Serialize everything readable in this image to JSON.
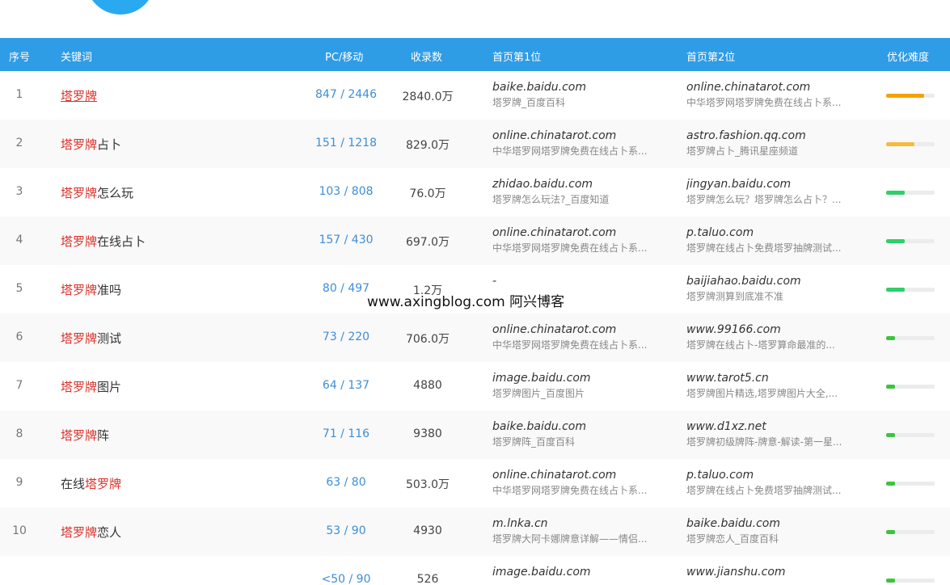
{
  "header": {
    "col_index": "序号",
    "col_keyword": "关键词",
    "col_pc_mobile": "PC/移动",
    "col_indexed": "收录数",
    "col_first": "首页第1位",
    "col_second": "首页第2位",
    "col_difficulty": "优化难度"
  },
  "watermark": "www.axingblog.com 阿兴博客",
  "colors": {
    "header_bg": "#2f9ce6",
    "highlight": "#d9332b",
    "pc_mobile": "#3d8ed8",
    "difficulty_high": "#f5a100",
    "difficulty_medium": "#f3bc3e",
    "difficulty_low": "#2dd06a",
    "difficulty_min": "#3cc43c"
  },
  "rows": [
    {
      "index": "1",
      "kw_prefix": "",
      "kw_highlight": "塔罗牌",
      "kw_suffix": "",
      "pc_mobile": "847 / 2446",
      "indexed": "2840.0万",
      "first_domain": "baike.baidu.com",
      "first_title": "塔罗牌_百度百科",
      "second_domain": "online.chinatarot.com",
      "second_title": "中华塔罗网塔罗牌免费在线占卜系...",
      "difficulty": 0.78,
      "difficulty_color": "#f5a100"
    },
    {
      "index": "2",
      "kw_prefix": "",
      "kw_highlight": "塔罗牌",
      "kw_suffix": "占卜",
      "pc_mobile": "151 / 1218",
      "indexed": "829.0万",
      "first_domain": "online.chinatarot.com",
      "first_title": "中华塔罗网塔罗牌免费在线占卜系...",
      "second_domain": "astro.fashion.qq.com",
      "second_title": "塔罗牌占卜_腾讯星座频道",
      "difficulty": 0.58,
      "difficulty_color": "#f3bc3e"
    },
    {
      "index": "3",
      "kw_prefix": "",
      "kw_highlight": "塔罗牌",
      "kw_suffix": "怎么玩",
      "pc_mobile": "103 / 808",
      "indexed": "76.0万",
      "first_domain": "zhidao.baidu.com",
      "first_title": "塔罗牌怎么玩法?_百度知道",
      "second_domain": "jingyan.baidu.com",
      "second_title": "塔罗牌怎么玩？塔罗牌怎么占卜？...",
      "difficulty": 0.38,
      "difficulty_color": "#2dd06a"
    },
    {
      "index": "4",
      "kw_prefix": "",
      "kw_highlight": "塔罗牌",
      "kw_suffix": "在线占卜",
      "pc_mobile": "157 / 430",
      "indexed": "697.0万",
      "first_domain": "online.chinatarot.com",
      "first_title": "中华塔罗网塔罗牌免费在线占卜系...",
      "second_domain": "p.taluo.com",
      "second_title": "塔罗牌在线占卜免费塔罗抽牌测试...",
      "difficulty": 0.38,
      "difficulty_color": "#2dd06a"
    },
    {
      "index": "5",
      "kw_prefix": "",
      "kw_highlight": "塔罗牌",
      "kw_suffix": "准吗",
      "pc_mobile": "80 / 497",
      "indexed": "1.2万",
      "first_domain": "-",
      "first_title": "",
      "second_domain": "baijiahao.baidu.com",
      "second_title": "塔罗牌测算到底准不准",
      "difficulty": 0.38,
      "difficulty_color": "#2dd06a"
    },
    {
      "index": "6",
      "kw_prefix": "",
      "kw_highlight": "塔罗牌",
      "kw_suffix": "测试",
      "pc_mobile": "73 / 220",
      "indexed": "706.0万",
      "first_domain": "online.chinatarot.com",
      "first_title": "中华塔罗网塔罗牌免费在线占卜系...",
      "second_domain": "www.99166.com",
      "second_title": "塔罗牌在线占卜-塔罗算命最准的...",
      "difficulty": 0.18,
      "difficulty_color": "#3cc43c"
    },
    {
      "index": "7",
      "kw_prefix": "",
      "kw_highlight": "塔罗牌",
      "kw_suffix": "图片",
      "pc_mobile": "64 / 137",
      "indexed": "4880",
      "first_domain": "image.baidu.com",
      "first_title": "塔罗牌图片_百度图片",
      "second_domain": "www.tarot5.cn",
      "second_title": "塔罗牌图片精选,塔罗牌图片大全,...",
      "difficulty": 0.18,
      "difficulty_color": "#3cc43c"
    },
    {
      "index": "8",
      "kw_prefix": "",
      "kw_highlight": "塔罗牌",
      "kw_suffix": "阵",
      "pc_mobile": "71 / 116",
      "indexed": "9380",
      "first_domain": "baike.baidu.com",
      "first_title": "塔罗牌阵_百度百科",
      "second_domain": "www.d1xz.net",
      "second_title": "塔罗牌初级牌阵-牌意-解读-第一星...",
      "difficulty": 0.18,
      "difficulty_color": "#3cc43c"
    },
    {
      "index": "9",
      "kw_prefix": "在线",
      "kw_highlight": "塔罗牌",
      "kw_suffix": "",
      "pc_mobile": "63 / 80",
      "indexed": "503.0万",
      "first_domain": "online.chinatarot.com",
      "first_title": "中华塔罗网塔罗牌免费在线占卜系...",
      "second_domain": "p.taluo.com",
      "second_title": "塔罗牌在线占卜免费塔罗抽牌测试...",
      "difficulty": 0.18,
      "difficulty_color": "#3cc43c"
    },
    {
      "index": "10",
      "kw_prefix": "",
      "kw_highlight": "塔罗牌",
      "kw_suffix": "恋人",
      "pc_mobile": "53 / 90",
      "indexed": "4930",
      "first_domain": "m.lnka.cn",
      "first_title": "塔罗牌大阿卡娜牌意详解——情侣...",
      "second_domain": "baike.baidu.com",
      "second_title": "塔罗牌恋人_百度百科",
      "difficulty": 0.18,
      "difficulty_color": "#3cc43c"
    },
    {
      "index": "",
      "kw_prefix": "",
      "kw_highlight": "",
      "kw_suffix": "",
      "pc_mobile": "<50 / 90",
      "indexed": "526",
      "first_domain": "image.baidu.com",
      "first_title": "",
      "second_domain": "www.jianshu.com",
      "second_title": "",
      "difficulty": 0.18,
      "difficulty_color": "#3cc43c"
    }
  ]
}
